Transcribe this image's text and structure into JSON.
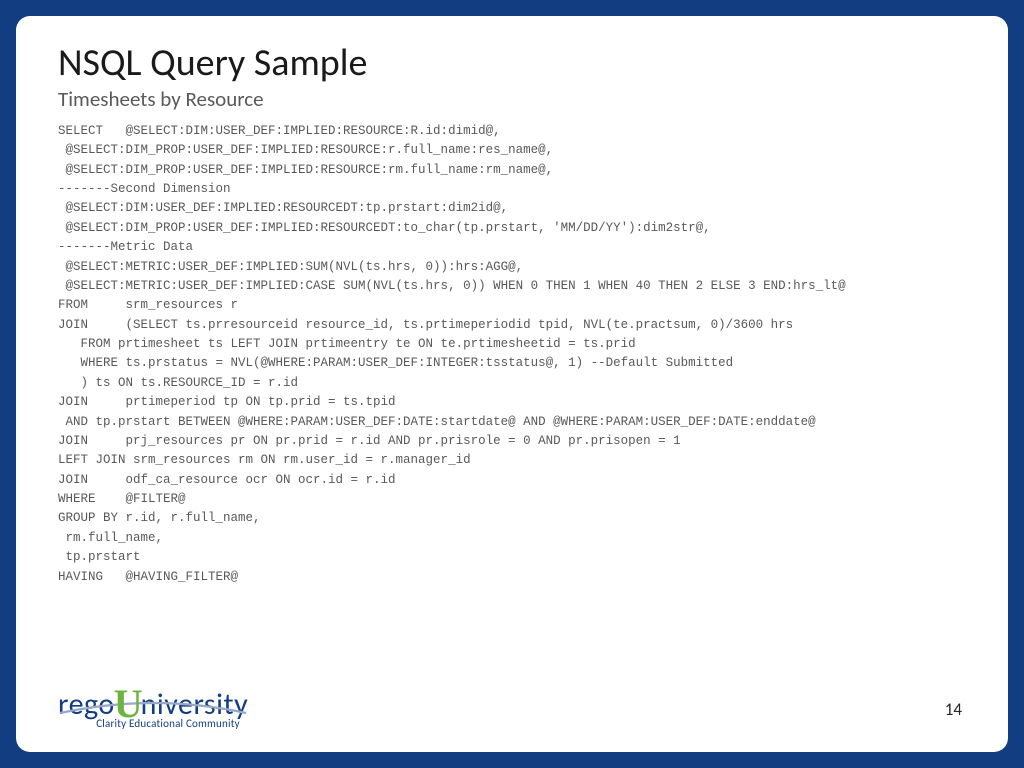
{
  "title": "NSQL Query Sample",
  "subtitle": "Timesheets by Resource",
  "code": "SELECT   @SELECT:DIM:USER_DEF:IMPLIED:RESOURCE:R.id:dimid@,\n @SELECT:DIM_PROP:USER_DEF:IMPLIED:RESOURCE:r.full_name:res_name@,\n @SELECT:DIM_PROP:USER_DEF:IMPLIED:RESOURCE:rm.full_name:rm_name@,\n-------Second Dimension\n @SELECT:DIM:USER_DEF:IMPLIED:RESOURCEDT:tp.prstart:dim2id@,\n @SELECT:DIM_PROP:USER_DEF:IMPLIED:RESOURCEDT:to_char(tp.prstart, 'MM/DD/YY'):dim2str@,\n-------Metric Data\n @SELECT:METRIC:USER_DEF:IMPLIED:SUM(NVL(ts.hrs, 0)):hrs:AGG@,\n @SELECT:METRIC:USER_DEF:IMPLIED:CASE SUM(NVL(ts.hrs, 0)) WHEN 0 THEN 1 WHEN 40 THEN 2 ELSE 3 END:hrs_lt@\nFROM     srm_resources r\nJOIN     (SELECT ts.prresourceid resource_id, ts.prtimeperiodid tpid, NVL(te.practsum, 0)/3600 hrs\n   FROM prtimesheet ts LEFT JOIN prtimeentry te ON te.prtimesheetid = ts.prid\n   WHERE ts.prstatus = NVL(@WHERE:PARAM:USER_DEF:INTEGER:tsstatus@, 1) --Default Submitted\n   ) ts ON ts.RESOURCE_ID = r.id\nJOIN     prtimeperiod tp ON tp.prid = ts.tpid\n AND tp.prstart BETWEEN @WHERE:PARAM:USER_DEF:DATE:startdate@ AND @WHERE:PARAM:USER_DEF:DATE:enddate@\nJOIN     prj_resources pr ON pr.prid = r.id AND pr.prisrole = 0 AND pr.prisopen = 1\nLEFT JOIN srm_resources rm ON rm.user_id = r.manager_id\nJOIN     odf_ca_resource ocr ON ocr.id = r.id\nWHERE    @FILTER@\nGROUP BY r.id, r.full_name,\n rm.full_name,\n tp.prstart\nHAVING   @HAVING_FILTER@",
  "logo": {
    "part1": "rego",
    "part2": "U",
    "part3": "niversity",
    "tagline": "Clarity Educational Community"
  },
  "page_number": "14"
}
